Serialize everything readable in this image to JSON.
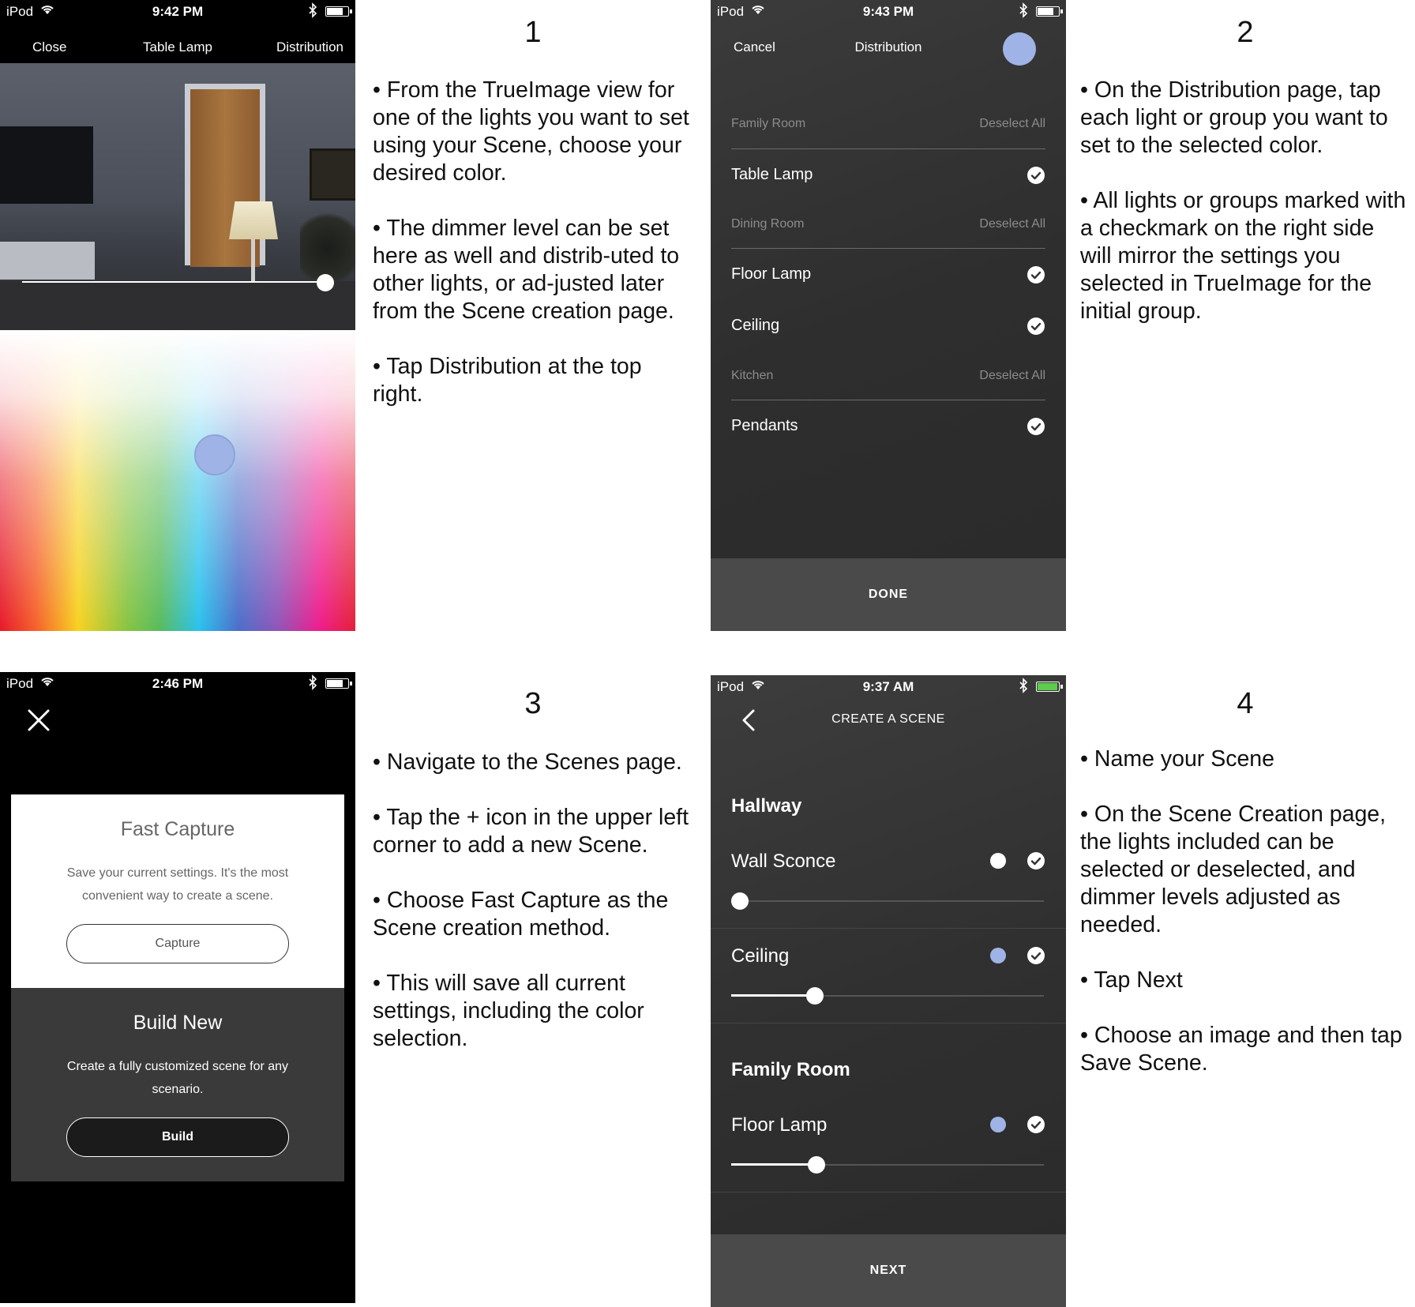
{
  "screen1": {
    "status": {
      "carrier": "iPod",
      "time": "9:42 PM"
    },
    "nav": {
      "left": "Close",
      "title": "Table Lamp",
      "right": "Distribution"
    },
    "dimmer_level": 0.92
  },
  "step1": {
    "number": "1",
    "bullets": [
      "• From the TrueImage view for one of the lights you want to set using your Scene, choose your desired color.",
      "• The dimmer level can be set here as well and distrib-uted to other lights, or ad-justed later from the Scene creation page.",
      "• Tap Distribution at the top right."
    ]
  },
  "screen2": {
    "status": {
      "carrier": "iPod",
      "time": "9:43 PM"
    },
    "nav": {
      "left": "Cancel",
      "title": "Distribution"
    },
    "selected_color": "#9fb3e6",
    "sections": [
      {
        "label": "Family Room",
        "action": "Deselect All",
        "lights": [
          "Table Lamp"
        ]
      },
      {
        "label": "Dining Room",
        "action": "Deselect All",
        "lights": [
          "Floor Lamp",
          "Ceiling"
        ]
      },
      {
        "label": "Kitchen",
        "action": "Deselect All",
        "lights": [
          "Pendants"
        ]
      }
    ],
    "done": "DONE"
  },
  "step2": {
    "number": "2",
    "bullets": [
      "• On the Distribution page, tap each light or group you want to set to the selected color.",
      "• All lights or groups marked with a checkmark on the right side will mirror the settings you selected in TrueImage for the initial group."
    ]
  },
  "screen3": {
    "status": {
      "carrier": "iPod",
      "time": "2:46 PM"
    },
    "fast_capture": {
      "title": "Fast Capture",
      "desc": "Save your current settings. It's the most convenient way to create a scene.",
      "button": "Capture"
    },
    "build_new": {
      "title": "Build New",
      "desc": "Create a fully customized scene for any scenario.",
      "button": "Build"
    }
  },
  "step3": {
    "number": "3",
    "bullets": [
      "• Navigate to the Scenes page.",
      "• Tap the + icon in the upper left corner to add a new Scene.",
      "• Choose Fast Capture as the Scene creation method.",
      "• This will save all current settings, including the color selection."
    ]
  },
  "screen4": {
    "status": {
      "carrier": "iPod",
      "time": "9:37 AM"
    },
    "nav": {
      "title": "CREATE A SCENE"
    },
    "groups": [
      {
        "name": "Hallway",
        "lights": [
          {
            "name": "Wall Sconce",
            "color": "#ffffff",
            "level": 0.0
          },
          {
            "name": "Ceiling",
            "color": "#9fb3e6",
            "level": 0.27
          }
        ]
      },
      {
        "name": "Family Room",
        "lights": [
          {
            "name": "Floor Lamp",
            "color": "#9fb3e6",
            "level": 0.27
          }
        ]
      }
    ],
    "next": "NEXT"
  },
  "step4": {
    "number": "4",
    "bullets": [
      "• Name your Scene",
      "• On the Scene Creation page, the lights included can be selected or deselected, and dimmer levels adjusted as needed.",
      "• Tap Next",
      "• Choose an image and then tap Save Scene."
    ]
  }
}
